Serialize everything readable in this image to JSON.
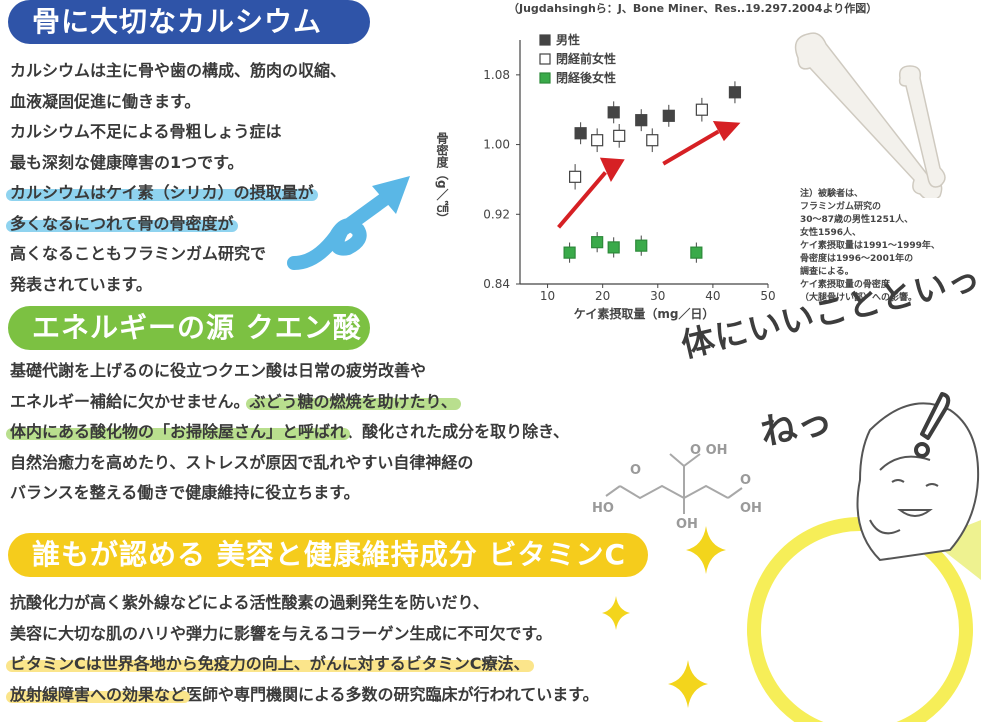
{
  "sections": {
    "calcium": {
      "title": "骨に大切なカルシウム",
      "lines": [
        {
          "text": "カルシウムは主に骨や歯の構成、筋肉の収縮、",
          "hl": ""
        },
        {
          "text": "血液凝固促進に働きます。",
          "hl": ""
        },
        {
          "text": "カルシウム不足による骨粗しょう症は",
          "hl": ""
        },
        {
          "text": "最も深刻な健康障害の1つです。",
          "hl": ""
        },
        {
          "text": "カルシウムはケイ素（シリカ）の摂取量が",
          "hl": "blue"
        },
        {
          "text": "多くなるにつれて骨の骨密度が",
          "hl": "blue"
        },
        {
          "text": "高くなることもフラミンガム研究で",
          "hl": ""
        },
        {
          "text": "発表されています。",
          "hl": ""
        }
      ]
    },
    "citric": {
      "title": "エネルギーの源 クエン酸",
      "lines": [
        {
          "pre": "基礎代謝を上げるのに役立つクエン酸は日常の疲労改善や",
          "mark": "",
          "post": ""
        },
        {
          "pre": "エネルギー補給に欠かせません。",
          "mark": "ぶどう糖の燃焼を助けたり、",
          "post": ""
        },
        {
          "pre": "",
          "mark": "体内にある酸化物の「お掃除屋さん」と呼ばれ",
          "post": "、酸化された成分を取り除き、"
        },
        {
          "pre": "自然治癒力を高めたり、ストレスが原因で乱れやすい自律神経の",
          "mark": "",
          "post": ""
        },
        {
          "pre": "バランスを整える働きで健康維持に役立ちます。",
          "mark": "",
          "post": ""
        }
      ]
    },
    "vitaminc": {
      "title": "誰もが認める 美容と健康維持成分 ビタミンC",
      "lines": [
        {
          "pre": "抗酸化力が高く紫外線などによる活性酸素の過剰発生を防いだり、",
          "mark": "",
          "post": ""
        },
        {
          "pre": "美容に大切な肌のハリや弾力に影響を与えるコラーゲン生成に不可欠です。",
          "mark": "",
          "post": ""
        },
        {
          "pre": "",
          "mark": "ビタミンCは世界各地から免疫力の向上、がんに対するビタミンC療法、",
          "post": ""
        },
        {
          "pre": "",
          "mark": "放射線障害への効果など",
          "post": "医師や専門機関による多数の研究臨床が行われています。"
        }
      ]
    }
  },
  "chart_caption": "（Jugdahsinghら：J、Bone Miner、Res..19.297.2004より作図）",
  "chart_data": {
    "type": "scatter",
    "title": "",
    "xlabel": "ケイ素摂取量（mg／日）",
    "ylabel": "骨密度（g／㎠）",
    "xlim": [
      5,
      50
    ],
    "ylim": [
      0.84,
      1.12
    ],
    "xticks": [
      "10",
      "20",
      "30",
      "40",
      "50"
    ],
    "yticks": [
      "0.84",
      "0.92",
      "1.00",
      "1.08"
    ],
    "legend_position": "top-left",
    "series": [
      {
        "name": "男性",
        "marker": "filled-dark",
        "color": "#444444",
        "points": [
          [
            16,
            1.013,
            0.008
          ],
          [
            22,
            1.037,
            0.008
          ],
          [
            27,
            1.028,
            0.008
          ],
          [
            32,
            1.033,
            0.008
          ],
          [
            44,
            1.06,
            0.008
          ]
        ]
      },
      {
        "name": "閉経前女性",
        "marker": "open",
        "color": "#444444",
        "points": [
          [
            15,
            0.963,
            0.01
          ],
          [
            19,
            1.005,
            0.009
          ],
          [
            23,
            1.01,
            0.009
          ],
          [
            29,
            1.005,
            0.009
          ],
          [
            38,
            1.04,
            0.009
          ]
        ]
      },
      {
        "name": "閉経後女性",
        "marker": "filled-green",
        "color": "#3aaa4a",
        "points": [
          [
            14,
            0.876,
            0.007
          ],
          [
            19,
            0.888,
            0.007
          ],
          [
            22,
            0.882,
            0.007
          ],
          [
            27,
            0.884,
            0.007
          ],
          [
            37,
            0.876,
            0.007
          ]
        ]
      }
    ]
  },
  "notes": [
    "注）被験者は、",
    "フラミンガム研究の",
    "30～87歳の男性1251人、",
    "女性1596人、",
    "ケイ素摂取量は1991～1999年、",
    "骨密度は1996～2001年の",
    "調査による。",
    "ケイ素摂取量の骨密度",
    "（大腿骨けい部）への影響。"
  ],
  "slogan": {
    "line1": "体にいいことといっぱい",
    "line2": "ねっ"
  },
  "molecule": {
    "oh_top": "O  OH",
    "o_right": "O",
    "ho_left": "HO",
    "oh_center": "OH",
    "o_right2": "O",
    "oh_right": "OH",
    "o_left": "O"
  },
  "colors": {
    "blue": "#2f54a8",
    "green": "#7cc142",
    "yellow": "#f5cc1c",
    "arrow": "#d62024",
    "swoosh": "#5ab7e6"
  }
}
